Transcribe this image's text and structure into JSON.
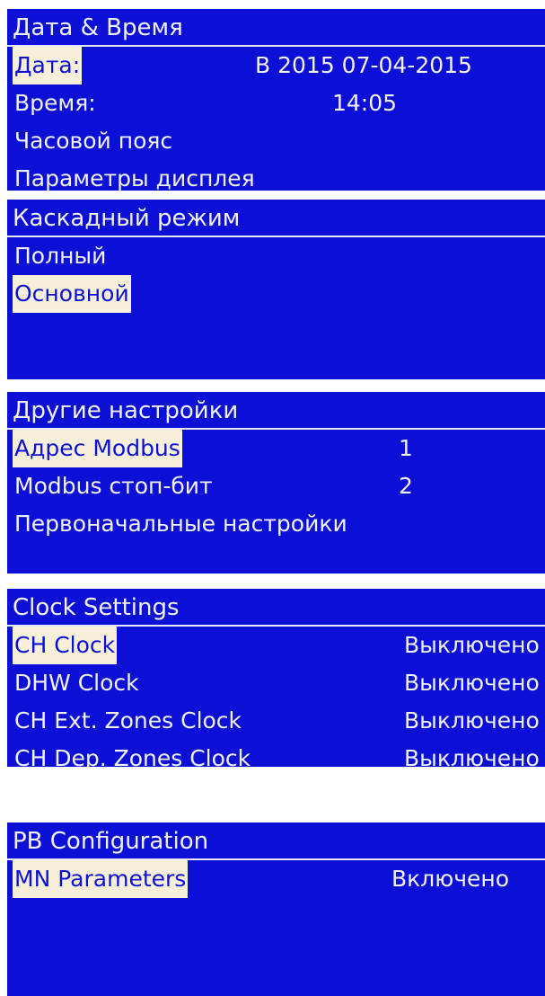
{
  "panels": [
    {
      "title": "Дата & Время",
      "rows": [
        {
          "label": "Дата:",
          "value": "В  2015 07-04-2015",
          "selected": true
        },
        {
          "label": "Время:",
          "value": "14:05",
          "selected": false
        },
        {
          "label": "Часовой пояс",
          "value": "",
          "selected": false
        },
        {
          "label": "Параметры дисплея",
          "value": "",
          "selected": false
        }
      ]
    },
    {
      "title": "Каскадный режим",
      "rows": [
        {
          "label": "Полный",
          "selected": false
        },
        {
          "label": "Основной",
          "selected": true
        }
      ]
    },
    {
      "title": "Другие настройки",
      "rows": [
        {
          "label": "Адрес Modbus",
          "value": "1",
          "selected": true
        },
        {
          "label": "Modbus стоп-бит",
          "value": "2",
          "selected": false
        },
        {
          "label": "Первоначальные настройки",
          "value": "",
          "selected": false
        }
      ]
    },
    {
      "title": "Clock Settings",
      "rows": [
        {
          "label": "CH Clock",
          "value": "Выключено",
          "selected": true
        },
        {
          "label": "DHW Clock",
          "value": "Выключено",
          "selected": false
        },
        {
          "label": "CH Ext. Zones Clock",
          "value": "Выключено",
          "selected": false
        },
        {
          "label": "CH Dep. Zones Clock",
          "value": "Выключено",
          "selected": false
        }
      ]
    },
    {
      "title": "PB Configuration",
      "rows": [
        {
          "label": "MN Parameters",
          "value": "Включено",
          "selected": true
        }
      ]
    }
  ],
  "colors": {
    "screen_background": "#0c10d6",
    "text": "#f2f2f8",
    "selection_highlight": "#f6f0da"
  }
}
